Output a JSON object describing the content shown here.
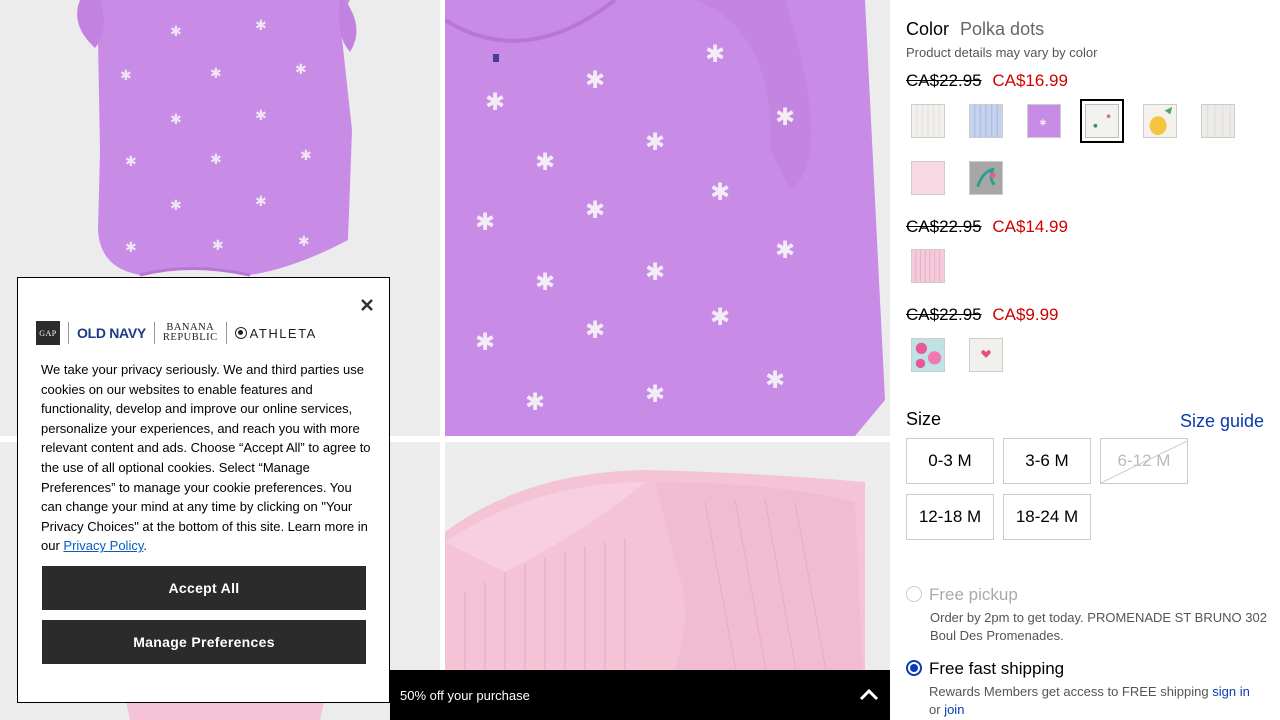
{
  "product": {
    "color_label": "Color",
    "color_value": "Polka dots",
    "vary_note": "Product details may vary by color",
    "price_groups": [
      {
        "old": "CA$22.95",
        "new": "CA$16.99"
      },
      {
        "old": "CA$22.95",
        "new": "CA$14.99"
      },
      {
        "old": "CA$22.95",
        "new": "CA$9.99"
      }
    ],
    "swatches": [
      {
        "name": "cream-stripe-swatch",
        "selected": false
      },
      {
        "name": "blue-stripe-swatch",
        "selected": false
      },
      {
        "name": "purple-palm-swatch",
        "selected": false
      },
      {
        "name": "polka-dots-swatch",
        "selected": true
      },
      {
        "name": "pineapple-swatch",
        "selected": false
      },
      {
        "name": "grey-stripe-swatch",
        "selected": false
      },
      {
        "name": "pink-solid-swatch",
        "selected": false
      },
      {
        "name": "mermaid-swatch",
        "selected": false
      },
      {
        "name": "pink-stripe-swatch",
        "selected": false
      },
      {
        "name": "floral-swatch",
        "selected": false
      },
      {
        "name": "heart-swatch",
        "selected": false
      }
    ],
    "size_label": "Size",
    "size_guide": "Size guide",
    "sizes": [
      {
        "label": "0-3 M",
        "available": true
      },
      {
        "label": "3-6 M",
        "available": true
      },
      {
        "label": "6-12 M",
        "available": false
      },
      {
        "label": "12-18 M",
        "available": true
      },
      {
        "label": "18-24 M",
        "available": true
      }
    ],
    "fulfillment": {
      "pickup_title": "Free pickup",
      "pickup_desc_1": "Order by 2pm to get today. PROMENADE ST BRUNO 302",
      "pickup_desc_2": "Boul Des Promenades.",
      "shipping_title": "Free fast shipping",
      "shipping_desc": "Rewards Members get access to FREE shipping",
      "sign_in": "sign in",
      "or": "or",
      "join": "join"
    }
  },
  "promo": {
    "text": "50% off your purchase"
  },
  "cookie": {
    "brands": {
      "gap": "GAP",
      "old_navy": "OLD NAVY",
      "banana_1": "BANANA",
      "banana_2": "REPUBLIC",
      "athleta": "ATHLETA"
    },
    "body": "We take your privacy seriously. We and third parties use cookies on our websites to enable features and functionality, develop and improve our online services, personalize your experiences, and reach you with more relevant content and ads. Choose “Accept All” to agree to the use of all optional cookies. Select “Manage Preferences” to manage your cookie preferences. You can change your mind at any time by clicking on \"Your Privacy Choices\" at the bottom of this site. Learn more in our",
    "link": "Privacy Policy",
    "period": ".",
    "accept": "Accept All",
    "manage": "Manage Preferences"
  },
  "colors": {
    "accent_blue": "#0a3bb2",
    "sale_red": "#d00000",
    "lilac": "#c98ce6",
    "pink": "#f4c3d6"
  }
}
